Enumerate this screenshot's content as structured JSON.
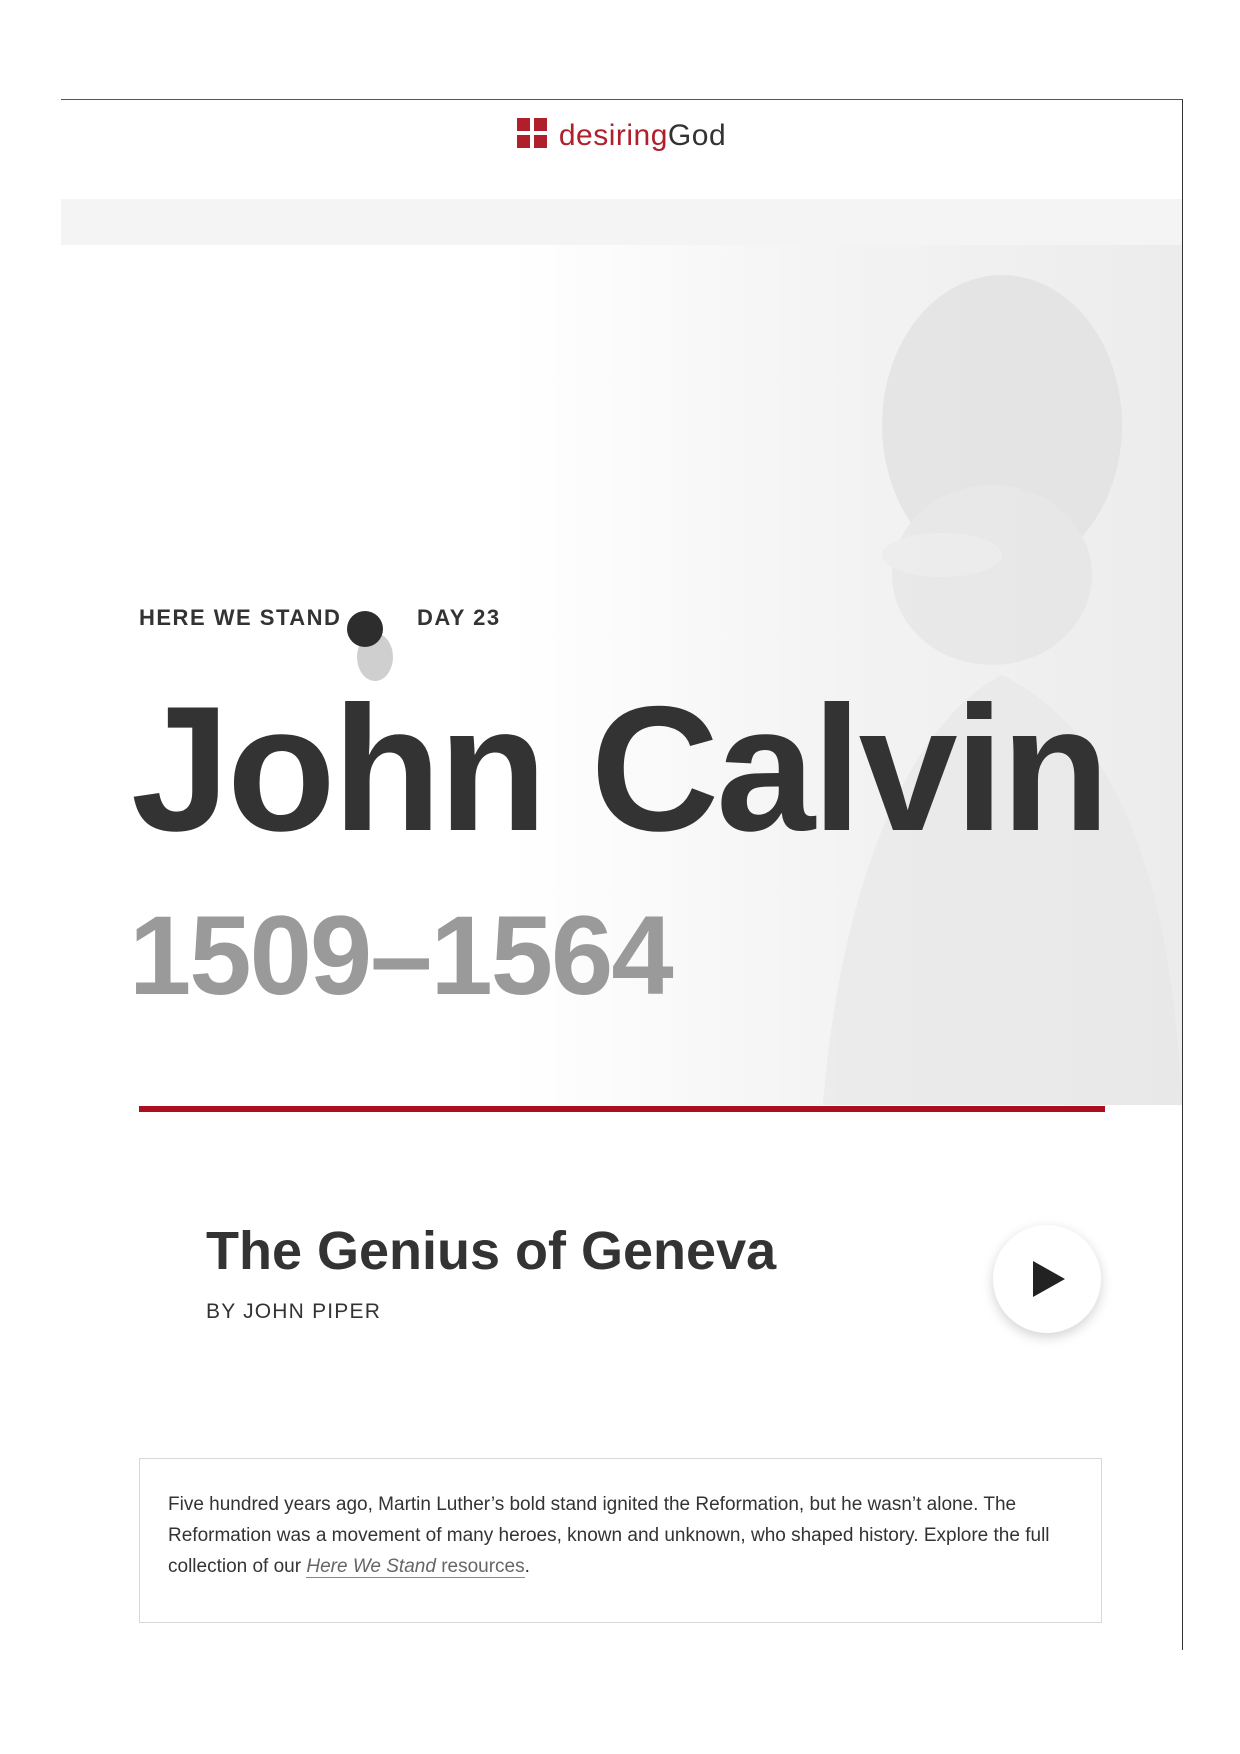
{
  "brand": {
    "logo_word_1": "desiring",
    "logo_word_2": "God",
    "accent_color": "#a90f1e"
  },
  "hero": {
    "series": "HERE WE STAND",
    "day": "DAY 23",
    "name": "John Calvin",
    "dates": "1509–1564"
  },
  "article": {
    "title": "The Genius of Geneva",
    "byline": "BY JOHN PIPER",
    "play_icon": "play-icon"
  },
  "note": {
    "text_before": "Five hundred years ago, Martin Luther’s bold stand ignited the Reformation, but he wasn’t alone. The Reformation was a movement of many heroes, known and unknown, who shaped history. Explore the full collection of our ",
    "link_italic": "Here We Stand",
    "link_rest": " resources",
    "text_after": "."
  }
}
